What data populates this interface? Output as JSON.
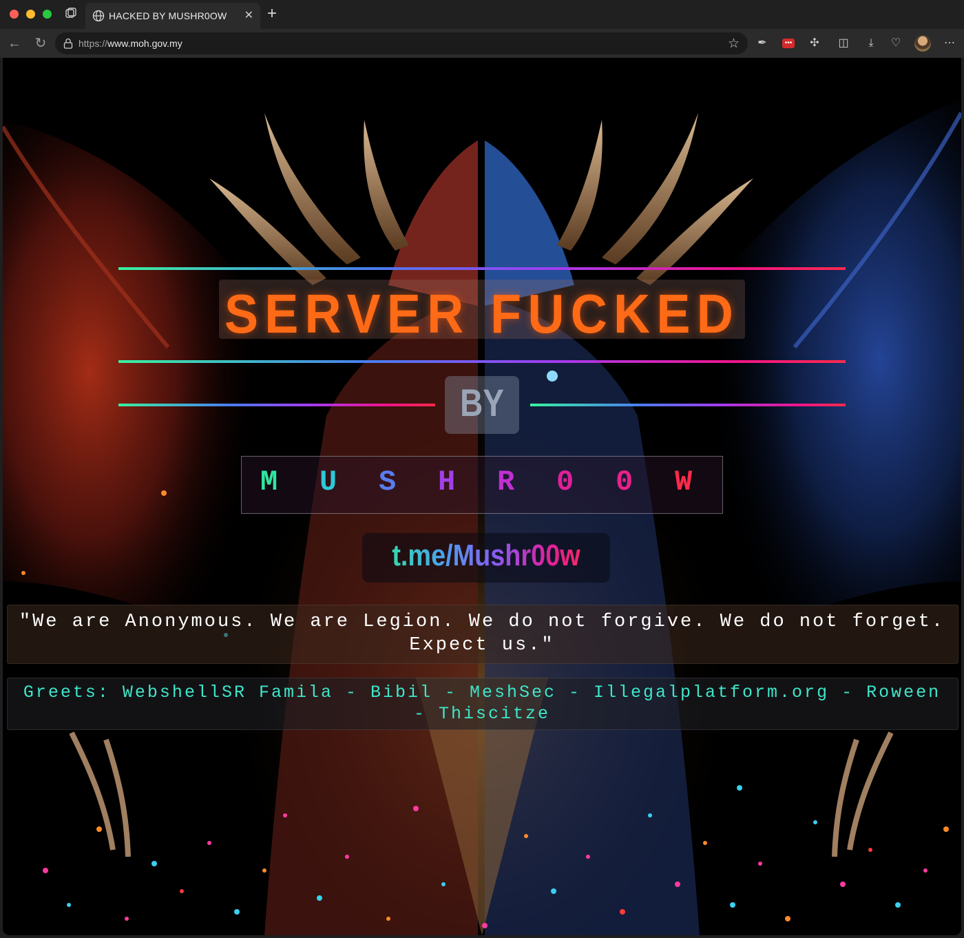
{
  "browser": {
    "tab_title": "HACKED BY MUSHR0OW",
    "url_scheme": "https://",
    "url_host": "www.moh.gov.my"
  },
  "page": {
    "headline": "SERVER FUCKED",
    "by": "BY",
    "name_letters": [
      "M",
      "U",
      "S",
      "H",
      "R",
      "0",
      "0",
      "W"
    ],
    "name_colors": [
      "#2ee6a0",
      "#2ec8d8",
      "#5a7cf0",
      "#a040e8",
      "#c030d0",
      "#e0209a",
      "#e8208a",
      "#ff2a4a"
    ],
    "telegram": "t.me/Mushr00w",
    "quote": "\"We are Anonymous. We are Legion. We do not forgive. We do not forget. Expect us.\"",
    "greets": "Greets: WebshellSR Famila - Bibil - MeshSec - Illegalplatform.org - Roween - Thiscitze"
  },
  "colors": {
    "headline": "#ff6a16",
    "greets": "#3ee6c8",
    "background": "#000000"
  }
}
